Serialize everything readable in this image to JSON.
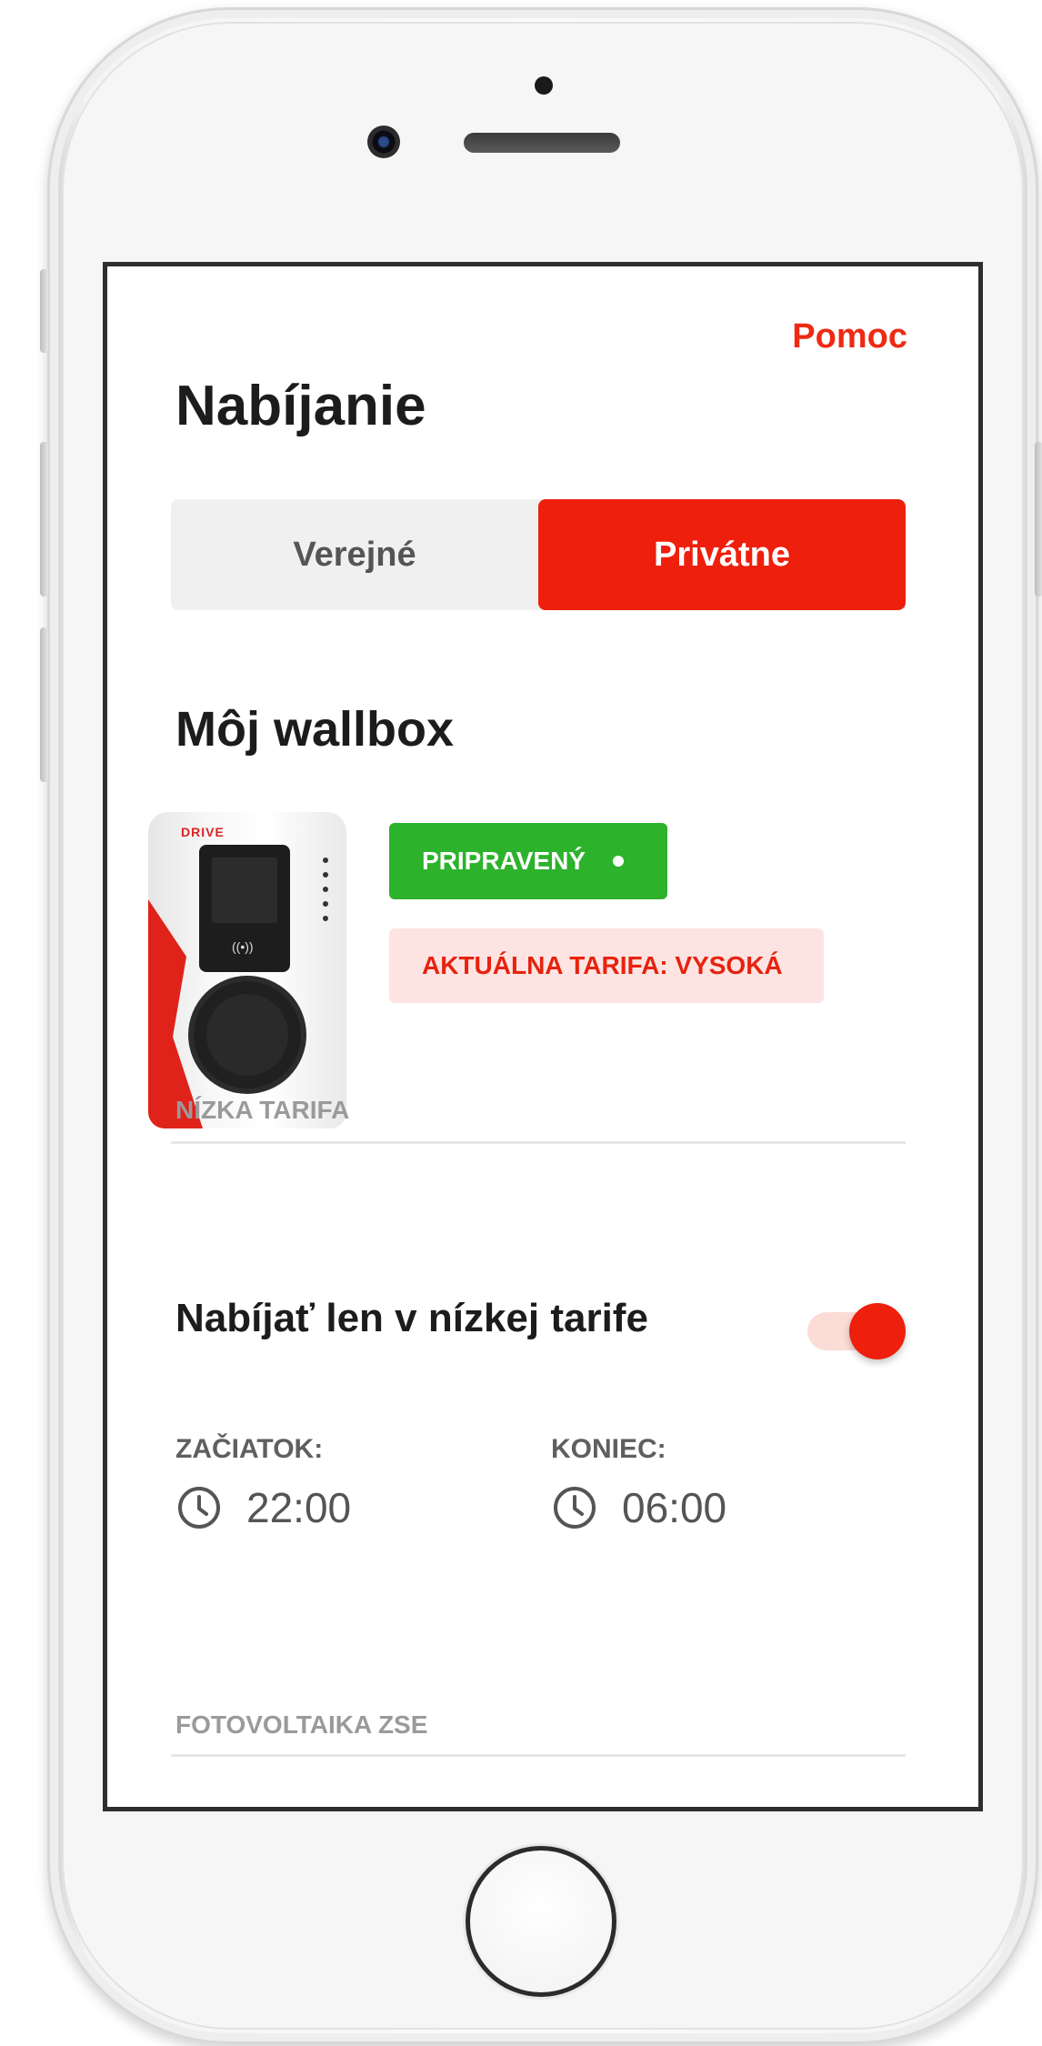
{
  "header": {
    "help_label": "Pomoc",
    "title": "Nabíjanie"
  },
  "tabs": [
    {
      "label": "Verejné",
      "active": false
    },
    {
      "label": "Privátne",
      "active": true
    }
  ],
  "wallbox": {
    "section_title": "Môj wallbox",
    "status_label": "PRIPRAVENÝ",
    "status_color": "#2db22c",
    "tariff_label": "AKTUÁLNA TARIFA: VYSOKÁ",
    "device_brand": "DRIVE"
  },
  "low_tariff": {
    "section_label": "NÍZKA TARIFA",
    "toggle_label": "Nabíjať len v nízkej tarife",
    "toggle_on": true,
    "start_label": "ZAČIATOK:",
    "start_time": "22:00",
    "end_label": "KONIEC:",
    "end_time": "06:00"
  },
  "photovoltaics": {
    "section_label": "FOTOVOLTAIKA ZSE"
  },
  "colors": {
    "accent": "#ee1f0c",
    "success": "#2db22c",
    "tariff_bg": "#fde4e2"
  }
}
